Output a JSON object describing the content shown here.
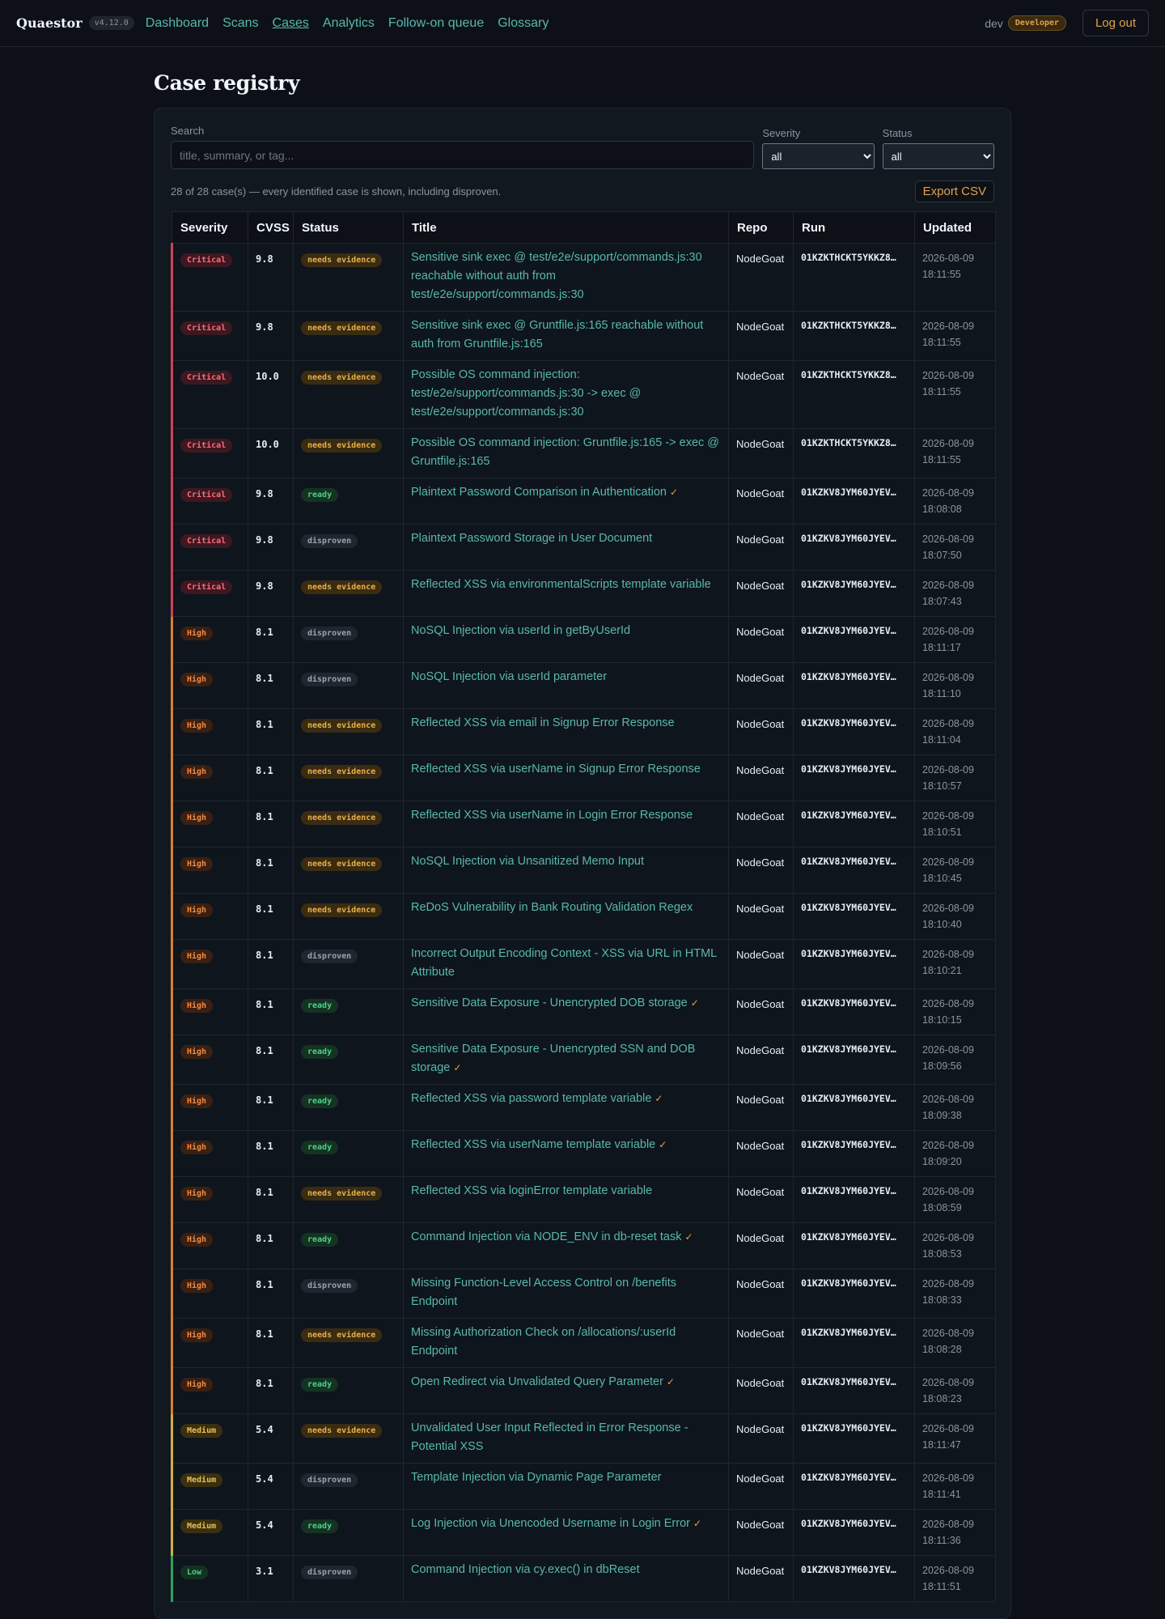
{
  "app": {
    "name": "Quaestor",
    "version": "v4.12.0",
    "nav": [
      "Dashboard",
      "Scans",
      "Cases",
      "Analytics",
      "Follow-on queue",
      "Glossary"
    ],
    "active_nav": "Cases",
    "user": "dev",
    "role": "Developer",
    "logout_label": "Log out"
  },
  "page": {
    "title": "Case registry",
    "search_label": "Search",
    "search_placeholder": "title, summary, or tag...",
    "search_value": "",
    "severity_label": "Severity",
    "severity_value": "all",
    "status_label": "Status",
    "status_value": "all",
    "summary": "28 of 28 case(s) — every identified case is shown, including disproven.",
    "export_label": "Export CSV"
  },
  "table": {
    "columns": [
      "Severity",
      "CVSS",
      "Status",
      "Title",
      "Repo",
      "Run",
      "Updated"
    ],
    "rows": [
      {
        "severity": "Critical",
        "cvss": "9.8",
        "status": "needs evidence",
        "title": "Sensitive sink exec @ test/e2e/support/commands.js:30 reachable without auth from test/e2e/support/commands.js:30",
        "check": false,
        "repo": "NodeGoat",
        "run": "01KZKTHCKT5YKKZ8…",
        "date": "2026-08-09",
        "time": "18:11:55"
      },
      {
        "severity": "Critical",
        "cvss": "9.8",
        "status": "needs evidence",
        "title": "Sensitive sink exec @ Gruntfile.js:165 reachable without auth from Gruntfile.js:165",
        "check": false,
        "repo": "NodeGoat",
        "run": "01KZKTHCKT5YKKZ8…",
        "date": "2026-08-09",
        "time": "18:11:55"
      },
      {
        "severity": "Critical",
        "cvss": "10.0",
        "status": "needs evidence",
        "title": "Possible OS command injection: test/e2e/support/commands.js:30 -> exec @ test/e2e/support/commands.js:30",
        "check": false,
        "repo": "NodeGoat",
        "run": "01KZKTHCKT5YKKZ8…",
        "date": "2026-08-09",
        "time": "18:11:55"
      },
      {
        "severity": "Critical",
        "cvss": "10.0",
        "status": "needs evidence",
        "title": "Possible OS command injection: Gruntfile.js:165 -> exec @ Gruntfile.js:165",
        "check": false,
        "repo": "NodeGoat",
        "run": "01KZKTHCKT5YKKZ8…",
        "date": "2026-08-09",
        "time": "18:11:55"
      },
      {
        "severity": "Critical",
        "cvss": "9.8",
        "status": "ready",
        "title": "Plaintext Password Comparison in Authentication",
        "check": true,
        "repo": "NodeGoat",
        "run": "01KZKV8JYM60JYEV…",
        "date": "2026-08-09",
        "time": "18:08:08"
      },
      {
        "severity": "Critical",
        "cvss": "9.8",
        "status": "disproven",
        "title": "Plaintext Password Storage in User Document",
        "check": false,
        "repo": "NodeGoat",
        "run": "01KZKV8JYM60JYEV…",
        "date": "2026-08-09",
        "time": "18:07:50"
      },
      {
        "severity": "Critical",
        "cvss": "9.8",
        "status": "needs evidence",
        "title": "Reflected XSS via environmentalScripts template variable",
        "check": false,
        "repo": "NodeGoat",
        "run": "01KZKV8JYM60JYEV…",
        "date": "2026-08-09",
        "time": "18:07:43"
      },
      {
        "severity": "High",
        "cvss": "8.1",
        "status": "disproven",
        "title": "NoSQL Injection via userId in getByUserId",
        "check": false,
        "repo": "NodeGoat",
        "run": "01KZKV8JYM60JYEV…",
        "date": "2026-08-09",
        "time": "18:11:17"
      },
      {
        "severity": "High",
        "cvss": "8.1",
        "status": "disproven",
        "title": "NoSQL Injection via userId parameter",
        "check": false,
        "repo": "NodeGoat",
        "run": "01KZKV8JYM60JYEV…",
        "date": "2026-08-09",
        "time": "18:11:10"
      },
      {
        "severity": "High",
        "cvss": "8.1",
        "status": "needs evidence",
        "title": "Reflected XSS via email in Signup Error Response",
        "check": false,
        "repo": "NodeGoat",
        "run": "01KZKV8JYM60JYEV…",
        "date": "2026-08-09",
        "time": "18:11:04"
      },
      {
        "severity": "High",
        "cvss": "8.1",
        "status": "needs evidence",
        "title": "Reflected XSS via userName in Signup Error Response",
        "check": false,
        "repo": "NodeGoat",
        "run": "01KZKV8JYM60JYEV…",
        "date": "2026-08-09",
        "time": "18:10:57"
      },
      {
        "severity": "High",
        "cvss": "8.1",
        "status": "needs evidence",
        "title": "Reflected XSS via userName in Login Error Response",
        "check": false,
        "repo": "NodeGoat",
        "run": "01KZKV8JYM60JYEV…",
        "date": "2026-08-09",
        "time": "18:10:51"
      },
      {
        "severity": "High",
        "cvss": "8.1",
        "status": "needs evidence",
        "title": "NoSQL Injection via Unsanitized Memo Input",
        "check": false,
        "repo": "NodeGoat",
        "run": "01KZKV8JYM60JYEV…",
        "date": "2026-08-09",
        "time": "18:10:45"
      },
      {
        "severity": "High",
        "cvss": "8.1",
        "status": "needs evidence",
        "title": "ReDoS Vulnerability in Bank Routing Validation Regex",
        "check": false,
        "repo": "NodeGoat",
        "run": "01KZKV8JYM60JYEV…",
        "date": "2026-08-09",
        "time": "18:10:40"
      },
      {
        "severity": "High",
        "cvss": "8.1",
        "status": "disproven",
        "title": "Incorrect Output Encoding Context - XSS via URL in HTML Attribute",
        "check": false,
        "repo": "NodeGoat",
        "run": "01KZKV8JYM60JYEV…",
        "date": "2026-08-09",
        "time": "18:10:21"
      },
      {
        "severity": "High",
        "cvss": "8.1",
        "status": "ready",
        "title": "Sensitive Data Exposure - Unencrypted DOB storage",
        "check": true,
        "repo": "NodeGoat",
        "run": "01KZKV8JYM60JYEV…",
        "date": "2026-08-09",
        "time": "18:10:15"
      },
      {
        "severity": "High",
        "cvss": "8.1",
        "status": "ready",
        "title": "Sensitive Data Exposure - Unencrypted SSN and DOB storage",
        "check": true,
        "repo": "NodeGoat",
        "run": "01KZKV8JYM60JYEV…",
        "date": "2026-08-09",
        "time": "18:09:56"
      },
      {
        "severity": "High",
        "cvss": "8.1",
        "status": "ready",
        "title": "Reflected XSS via password template variable",
        "check": true,
        "repo": "NodeGoat",
        "run": "01KZKV8JYM60JYEV…",
        "date": "2026-08-09",
        "time": "18:09:38"
      },
      {
        "severity": "High",
        "cvss": "8.1",
        "status": "ready",
        "title": "Reflected XSS via userName template variable",
        "check": true,
        "repo": "NodeGoat",
        "run": "01KZKV8JYM60JYEV…",
        "date": "2026-08-09",
        "time": "18:09:20"
      },
      {
        "severity": "High",
        "cvss": "8.1",
        "status": "needs evidence",
        "title": "Reflected XSS via loginError template variable",
        "check": false,
        "repo": "NodeGoat",
        "run": "01KZKV8JYM60JYEV…",
        "date": "2026-08-09",
        "time": "18:08:59"
      },
      {
        "severity": "High",
        "cvss": "8.1",
        "status": "ready",
        "title": "Command Injection via NODE_ENV in db-reset task",
        "check": true,
        "repo": "NodeGoat",
        "run": "01KZKV8JYM60JYEV…",
        "date": "2026-08-09",
        "time": "18:08:53"
      },
      {
        "severity": "High",
        "cvss": "8.1",
        "status": "disproven",
        "title": "Missing Function-Level Access Control on /benefits Endpoint",
        "check": false,
        "repo": "NodeGoat",
        "run": "01KZKV8JYM60JYEV…",
        "date": "2026-08-09",
        "time": "18:08:33"
      },
      {
        "severity": "High",
        "cvss": "8.1",
        "status": "needs evidence",
        "title": "Missing Authorization Check on /allocations/:userId Endpoint",
        "check": false,
        "repo": "NodeGoat",
        "run": "01KZKV8JYM60JYEV…",
        "date": "2026-08-09",
        "time": "18:08:28"
      },
      {
        "severity": "High",
        "cvss": "8.1",
        "status": "ready",
        "title": "Open Redirect via Unvalidated Query Parameter",
        "check": true,
        "repo": "NodeGoat",
        "run": "01KZKV8JYM60JYEV…",
        "date": "2026-08-09",
        "time": "18:08:23"
      },
      {
        "severity": "Medium",
        "cvss": "5.4",
        "status": "needs evidence",
        "title": "Unvalidated User Input Reflected in Error Response - Potential XSS",
        "check": false,
        "repo": "NodeGoat",
        "run": "01KZKV8JYM60JYEV…",
        "date": "2026-08-09",
        "time": "18:11:47"
      },
      {
        "severity": "Medium",
        "cvss": "5.4",
        "status": "disproven",
        "title": "Template Injection via Dynamic Page Parameter",
        "check": false,
        "repo": "NodeGoat",
        "run": "01KZKV8JYM60JYEV…",
        "date": "2026-08-09",
        "time": "18:11:41"
      },
      {
        "severity": "Medium",
        "cvss": "5.4",
        "status": "ready",
        "title": "Log Injection via Unencoded Username in Login Error",
        "check": true,
        "repo": "NodeGoat",
        "run": "01KZKV8JYM60JYEV…",
        "date": "2026-08-09",
        "time": "18:11:36"
      },
      {
        "severity": "Low",
        "cvss": "3.1",
        "status": "disproven",
        "title": "Command Injection via cy.exec() in dbReset",
        "check": false,
        "repo": "NodeGoat",
        "run": "01KZKV8JYM60JYEV…",
        "date": "2026-08-09",
        "time": "18:11:51"
      }
    ]
  },
  "colors": {
    "background": "#0d1117",
    "link": "#58b8ad",
    "accent": "#e3a14a",
    "critical": "#d04157",
    "high": "#d9802c",
    "medium": "#d3b03d",
    "low": "#2ea05c"
  },
  "icons": {
    "ready_check": "check-icon",
    "select_arrow": "chevron-down-icon"
  }
}
